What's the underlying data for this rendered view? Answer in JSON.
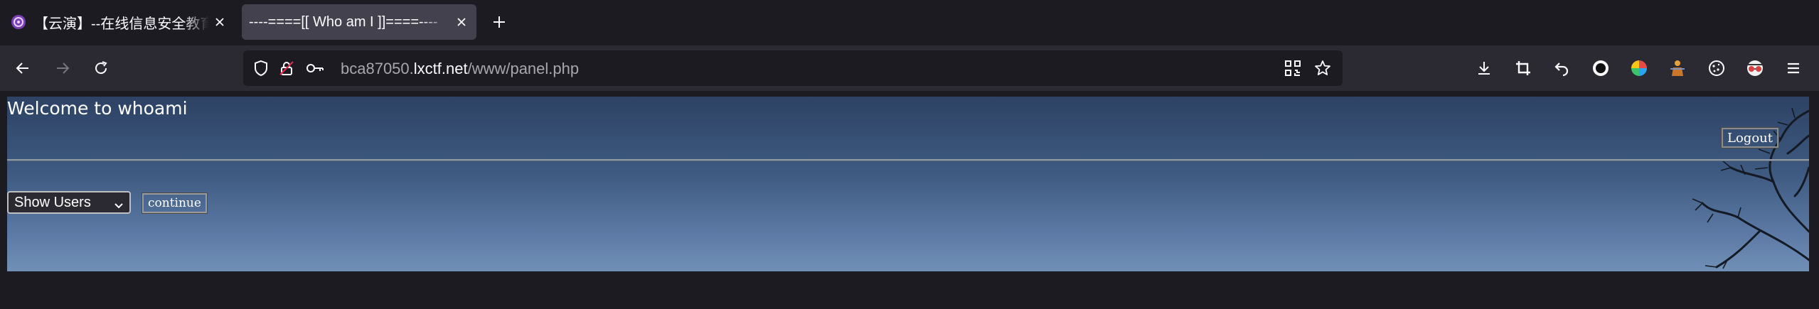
{
  "tabs": [
    {
      "title": "【云演】--在线信息安全教育平台",
      "favicon": "yunyan-logo-icon",
      "active": false
    },
    {
      "title": "----====[[ Who am I ]]====----",
      "favicon": "",
      "active": true
    }
  ],
  "url": {
    "prefix": "bca87050.",
    "host": "lxctf.net",
    "path": "/www/panel.php"
  },
  "page": {
    "welcome": "Welcome to whoami",
    "logout_label": "Logout",
    "select_value": "Show Users",
    "continue_label": "continue"
  },
  "colors": {
    "tab_strip": "#1c1b22",
    "active_tab": "#42414d",
    "navbar": "#2b2a33",
    "content_sky": "#3f5b82"
  },
  "toolbar_icons": [
    "download-icon",
    "crop-icon",
    "undo-icon",
    "record-icon",
    "color-wheel-icon",
    "extension-figure-icon",
    "cookie-icon",
    "glasses-icon",
    "menu-icon"
  ]
}
